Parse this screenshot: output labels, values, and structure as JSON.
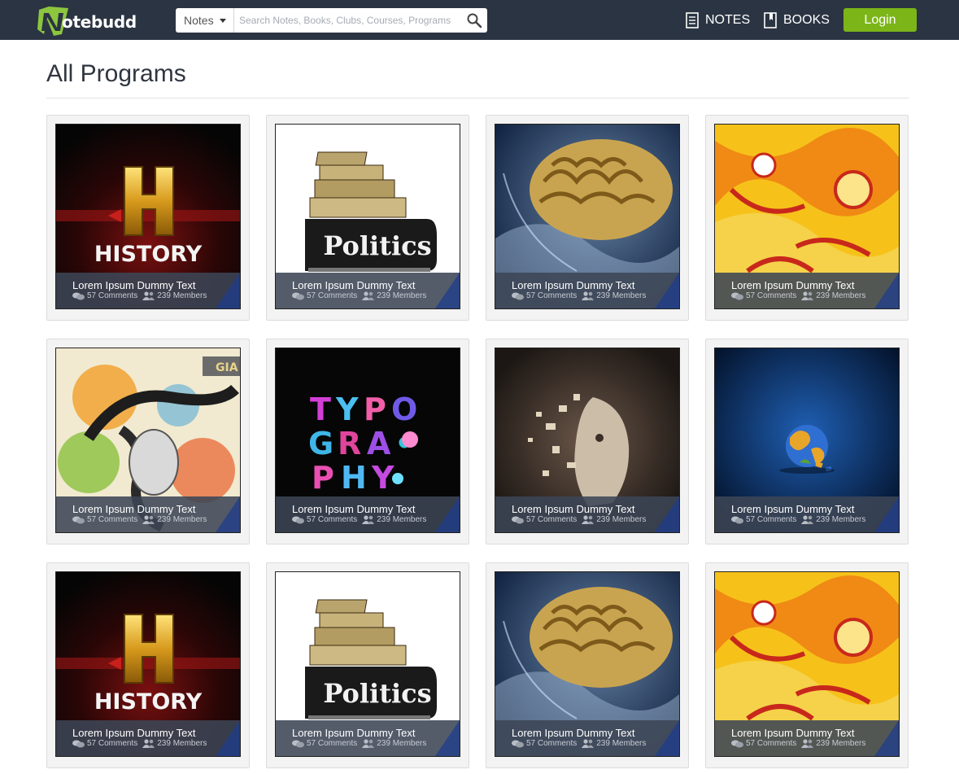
{
  "header": {
    "logo_text": "otebudd",
    "search": {
      "scope_label": "Notes",
      "placeholder": "Search Notes, Books, Clubs, Courses, Programs"
    },
    "nav": {
      "notes": "NOTES",
      "books": "BOOKS",
      "login": "Login"
    }
  },
  "page": {
    "title": "All Programs"
  },
  "cards": [
    {
      "art": "history",
      "art_text": "HISTORY",
      "title": "Lorem Ipsum Dummy Text",
      "comments": "57 Comments",
      "members": "239 Members"
    },
    {
      "art": "politics",
      "art_text": "Politics",
      "title": "Lorem Ipsum Dummy Text",
      "comments": "57 Comments",
      "members": "239 Members"
    },
    {
      "art": "brain",
      "title": "Lorem Ipsum Dummy Text",
      "comments": "57 Comments",
      "members": "239 Members"
    },
    {
      "art": "yellow",
      "title": "Lorem Ipsum Dummy Text",
      "comments": "57 Comments",
      "members": "239 Members"
    },
    {
      "art": "splash",
      "art_text": "GIA",
      "title": "Lorem Ipsum Dummy Text",
      "comments": "57 Comments",
      "members": "239 Members"
    },
    {
      "art": "typography",
      "title": "Lorem Ipsum Dummy Text",
      "comments": "57 Comments",
      "members": "239 Members"
    },
    {
      "art": "face",
      "title": "Lorem Ipsum Dummy Text",
      "comments": "57 Comments",
      "members": "239 Members"
    },
    {
      "art": "globe",
      "title": "Lorem Ipsum Dummy Text",
      "comments": "57 Comments",
      "members": "239 Members"
    },
    {
      "art": "history",
      "art_text": "HISTORY",
      "title": "Lorem Ipsum Dummy Text",
      "comments": "57 Comments",
      "members": "239 Members"
    },
    {
      "art": "politics",
      "art_text": "Politics",
      "title": "Lorem Ipsum Dummy Text",
      "comments": "57 Comments",
      "members": "239 Members"
    },
    {
      "art": "brain",
      "title": "Lorem Ipsum Dummy Text",
      "comments": "57 Comments",
      "members": "239 Members"
    },
    {
      "art": "yellow",
      "title": "Lorem Ipsum Dummy Text",
      "comments": "57 Comments",
      "members": "239 Members"
    }
  ]
}
